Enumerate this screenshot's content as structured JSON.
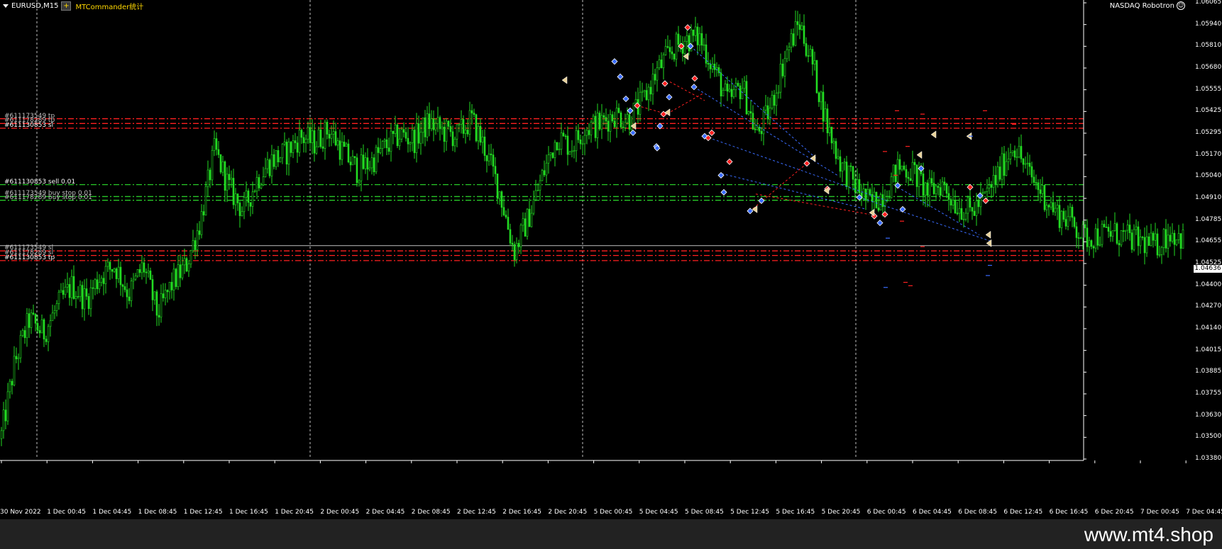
{
  "window": {
    "symbol": "EURUSD,M15",
    "ea_name": "MTCommander统计",
    "plus_label": "+",
    "robot_label": "NASDAQ Robotron",
    "robot_icon": "smiley-icon"
  },
  "colors": {
    "background": "#000000",
    "candle": "#22dd22",
    "grid": "#c0c0c0",
    "sl_tp_line": "#ff2020",
    "pending_line": "#28c828",
    "current_price_line": "#c0c0c0",
    "trade_blue": "#3a6cff",
    "trade_red": "#ff2020"
  },
  "order_labels": [
    {
      "text": "#611173549 tp",
      "color": "#c0c0c0"
    },
    {
      "text": "#611178289 tp",
      "color": "#c0c0c0"
    },
    {
      "text": "#611130853 sl",
      "color": "#ffffff"
    },
    {
      "text": "#611130853 sell 0.01",
      "color": "#ffffff"
    },
    {
      "text": "#611173549 buy stop 0.01",
      "color": "#c0c0c0"
    },
    {
      "text": "#611178289 buy stop 0.01",
      "color": "#c0c0c0"
    },
    {
      "text": "#611173549 sl",
      "color": "#c0c0c0"
    },
    {
      "text": "#611178289 sl",
      "color": "#c0c0c0"
    },
    {
      "text": "#611130853 tp",
      "color": "#ffffff"
    }
  ],
  "chart_data": {
    "type": "candlestick",
    "symbol": "EURUSD",
    "timeframe": "M15",
    "y_ticks": [
      "1.06065",
      "1.05940",
      "1.05810",
      "1.05680",
      "1.05555",
      "1.05425",
      "1.05295",
      "1.05170",
      "1.05040",
      "1.04910",
      "1.04785",
      "1.04655",
      "1.04525",
      "1.04400",
      "1.04270",
      "1.04140",
      "1.04015",
      "1.03885",
      "1.03755",
      "1.03630",
      "1.03500",
      "1.03380"
    ],
    "x_ticks": [
      "30 Nov 2022",
      "1 Dec 00:45",
      "1 Dec 04:45",
      "1 Dec 08:45",
      "1 Dec 12:45",
      "1 Dec 16:45",
      "1 Dec 20:45",
      "2 Dec 00:45",
      "2 Dec 04:45",
      "2 Dec 08:45",
      "2 Dec 12:45",
      "2 Dec 16:45",
      "2 Dec 20:45",
      "5 Dec 00:45",
      "5 Dec 04:45",
      "5 Dec 08:45",
      "5 Dec 12:45",
      "5 Dec 16:45",
      "5 Dec 20:45",
      "6 Dec 00:45",
      "6 Dec 04:45",
      "6 Dec 08:45",
      "6 Dec 12:45",
      "6 Dec 16:45",
      "6 Dec 20:45",
      "7 Dec 00:45",
      "7 Dec 04:45"
    ],
    "ylim": [
      1.0338,
      1.06065
    ],
    "current_price": "1.04636",
    "current_price_value": 1.04636,
    "levels": [
      {
        "price": 1.05383,
        "kind": "tp"
      },
      {
        "price": 1.05355,
        "kind": "tp"
      },
      {
        "price": 1.05327,
        "kind": "sl"
      },
      {
        "price": 1.04995,
        "kind": "sell"
      },
      {
        "price": 1.04925,
        "kind": "buy-stop"
      },
      {
        "price": 1.04903,
        "kind": "buy-stop"
      },
      {
        "price": 1.04605,
        "kind": "sl"
      },
      {
        "price": 1.04578,
        "kind": "sl"
      },
      {
        "price": 1.04548,
        "kind": "tp"
      }
    ],
    "grid": true,
    "close_path": [
      [
        0,
        1.035
      ],
      [
        1,
        1.0395
      ],
      [
        2,
        1.042
      ],
      [
        3,
        1.0412
      ],
      [
        4,
        1.0428
      ],
      [
        5,
        1.044
      ],
      [
        6,
        1.0432
      ],
      [
        7,
        1.0446
      ],
      [
        8,
        1.0452
      ],
      [
        9,
        1.0435
      ],
      [
        10,
        1.0452
      ],
      [
        11,
        1.0423
      ],
      [
        12,
        1.0441
      ],
      [
        13,
        1.0452
      ],
      [
        14,
        1.0478
      ],
      [
        15,
        1.052
      ],
      [
        16,
        1.0498
      ],
      [
        17,
        1.0484
      ],
      [
        18,
        1.0503
      ],
      [
        19,
        1.0514
      ],
      [
        20,
        1.0518
      ],
      [
        21,
        1.0528
      ],
      [
        22,
        1.0524
      ],
      [
        23,
        1.0532
      ],
      [
        24,
        1.0519
      ],
      [
        25,
        1.0508
      ],
      [
        26,
        1.0513
      ],
      [
        27,
        1.0522
      ],
      [
        28,
        1.0529
      ],
      [
        29,
        1.0526
      ],
      [
        30,
        1.0536
      ],
      [
        31,
        1.0531
      ],
      [
        32,
        1.0528
      ],
      [
        33,
        1.0538
      ],
      [
        34,
        1.052
      ],
      [
        35,
        1.0495
      ],
      [
        36,
        1.046
      ],
      [
        37,
        1.048
      ],
      [
        38,
        1.0505
      ],
      [
        39,
        1.0528
      ],
      [
        40,
        1.0522
      ],
      [
        41,
        1.0533
      ],
      [
        42,
        1.0535
      ],
      [
        43,
        1.0541
      ],
      [
        44,
        1.0538
      ],
      [
        45,
        1.0548
      ],
      [
        46,
        1.0566
      ],
      [
        47,
        1.0578
      ],
      [
        48,
        1.0585
      ],
      [
        49,
        1.0586
      ],
      [
        50,
        1.0568
      ],
      [
        51,
        1.0548
      ],
      [
        52,
        1.0558
      ],
      [
        53,
        1.0528
      ],
      [
        54,
        1.0545
      ],
      [
        55,
        1.0575
      ],
      [
        56,
        1.0595
      ],
      [
        57,
        1.0568
      ],
      [
        58,
        1.0533
      ],
      [
        59,
        1.051
      ],
      [
        60,
        1.0498
      ],
      [
        61,
        1.0488
      ],
      [
        62,
        1.0495
      ],
      [
        63,
        1.051
      ],
      [
        64,
        1.0507
      ],
      [
        65,
        1.0495
      ],
      [
        66,
        1.05
      ],
      [
        67,
        1.0488
      ],
      [
        68,
        1.0483
      ],
      [
        69,
        1.0492
      ],
      [
        70,
        1.0506
      ],
      [
        71,
        1.0524
      ],
      [
        72,
        1.0507
      ],
      [
        73,
        1.0495
      ],
      [
        74,
        1.0483
      ],
      [
        75,
        1.0479
      ],
      [
        76,
        1.0468
      ],
      [
        77,
        1.047
      ],
      [
        78,
        1.0471
      ],
      [
        79,
        1.0468
      ],
      [
        80,
        1.0466
      ],
      [
        81,
        1.0463
      ],
      [
        82,
        1.0472
      ],
      [
        83,
        1.0467
      ]
    ],
    "annotations": {
      "blue_markers": [
        [
          866,
          1.0572
        ],
        [
          874,
          1.0563
        ],
        [
          882,
          1.055
        ],
        [
          888,
          1.0543
        ],
        [
          892,
          1.053
        ],
        [
          925,
          1.0522
        ],
        [
          930,
          1.0534
        ],
        [
          943,
          1.0551
        ],
        [
          978,
          1.0557
        ],
        [
          993,
          1.0528
        ],
        [
          1016,
          1.0505
        ],
        [
          1057,
          1.0484
        ],
        [
          1073,
          1.049
        ],
        [
          1211,
          1.0492
        ],
        [
          1240,
          1.0477
        ],
        [
          1265,
          1.0499
        ],
        [
          1272,
          1.0485
        ],
        [
          1298,
          1.0509
        ],
        [
          1381,
          1.0493
        ],
        [
          973,
          1.0581
        ],
        [
          1020,
          1.0495
        ],
        [
          926,
          1.0521
        ]
      ],
      "red_markers": [
        [
          898,
          1.0546
        ],
        [
          935,
          1.0541
        ],
        [
          937,
          1.0559
        ],
        [
          960,
          1.0581
        ],
        [
          969,
          1.0592
        ],
        [
          979,
          1.0562
        ],
        [
          998,
          1.0527
        ],
        [
          1028,
          1.0513
        ],
        [
          1137,
          1.0512
        ],
        [
          1166,
          1.0497
        ],
        [
          1247,
          1.0482
        ],
        [
          1367,
          1.0498
        ],
        [
          1389,
          1.049
        ],
        [
          1003,
          1.053
        ],
        [
          1232,
          1.0481
        ]
      ],
      "tan_markers": [
        [
          795,
          1.0561
        ],
        [
          892,
          1.0534
        ],
        [
          940,
          1.0542
        ],
        [
          966,
          1.0575
        ],
        [
          1063,
          1.0485
        ],
        [
          1145,
          1.0515
        ],
        [
          1228,
          1.0483
        ],
        [
          1295,
          1.0517
        ],
        [
          1315,
          1.0529
        ],
        [
          1365,
          1.0528
        ],
        [
          1392,
          1.047
        ],
        [
          1393,
          1.0465
        ],
        [
          1164,
          1.0496
        ]
      ],
      "blue_dash_lines": [
        [
          973,
          1.0581,
          1150,
          1.0515
        ],
        [
          993,
          1.0528,
          1250,
          1.049
        ],
        [
          1017,
          1.0506,
          1221,
          1.0485
        ],
        [
          1211,
          1.0492,
          1398,
          1.0466
        ],
        [
          978,
          1.0557,
          1180,
          1.0505
        ],
        [
          1265,
          1.0498,
          1380,
          1.047
        ]
      ],
      "red_dash_lines": [
        [
          898,
          1.0546,
          940,
          1.0541
        ],
        [
          944,
          1.056,
          993,
          1.0549
        ],
        [
          935,
          1.054,
          990,
          1.0553
        ],
        [
          1065,
          1.0494,
          1225,
          1.0482
        ],
        [
          1137,
          1.0512,
          1060,
          1.0485
        ]
      ]
    }
  },
  "footer": {
    "site": "www.mt4.shop"
  }
}
